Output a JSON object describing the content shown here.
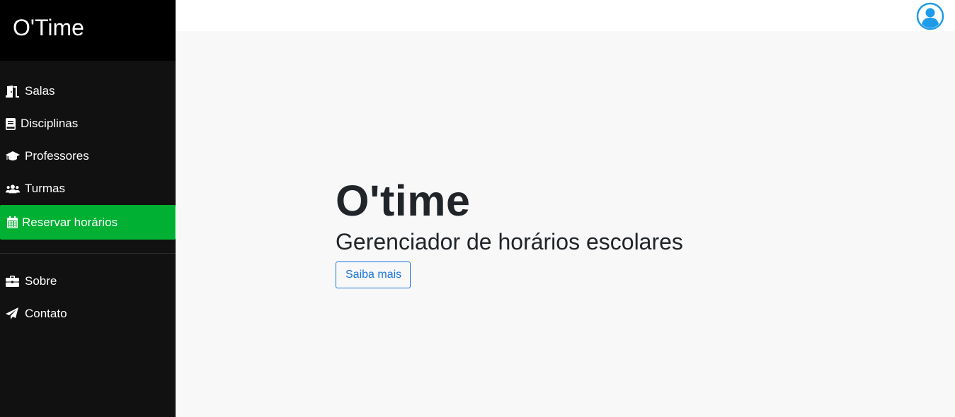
{
  "sidebar": {
    "brand": "O'Time",
    "items": [
      {
        "label": "Salas",
        "icon": "door-icon"
      },
      {
        "label": "Disciplinas",
        "icon": "book-icon"
      },
      {
        "label": "Professores",
        "icon": "graduation-cap-icon"
      },
      {
        "label": "Turmas",
        "icon": "users-icon"
      },
      {
        "label": "Reservar horários",
        "icon": "calendar-icon",
        "active": true
      }
    ],
    "secondary_items": [
      {
        "label": "Sobre",
        "icon": "briefcase-icon"
      },
      {
        "label": "Contato",
        "icon": "paper-plane-icon"
      }
    ]
  },
  "topbar": {
    "user_icon": "user-circle-icon"
  },
  "hero": {
    "title": "O'time",
    "subtitle": "Gerenciador de horários escolares",
    "button_label": "Saiba mais"
  },
  "colors": {
    "sidebar_bg": "#111111",
    "brand_bg": "#000000",
    "active_item": "#00b032",
    "primary": "#1a73d9",
    "user_icon": "#1e9be9"
  }
}
